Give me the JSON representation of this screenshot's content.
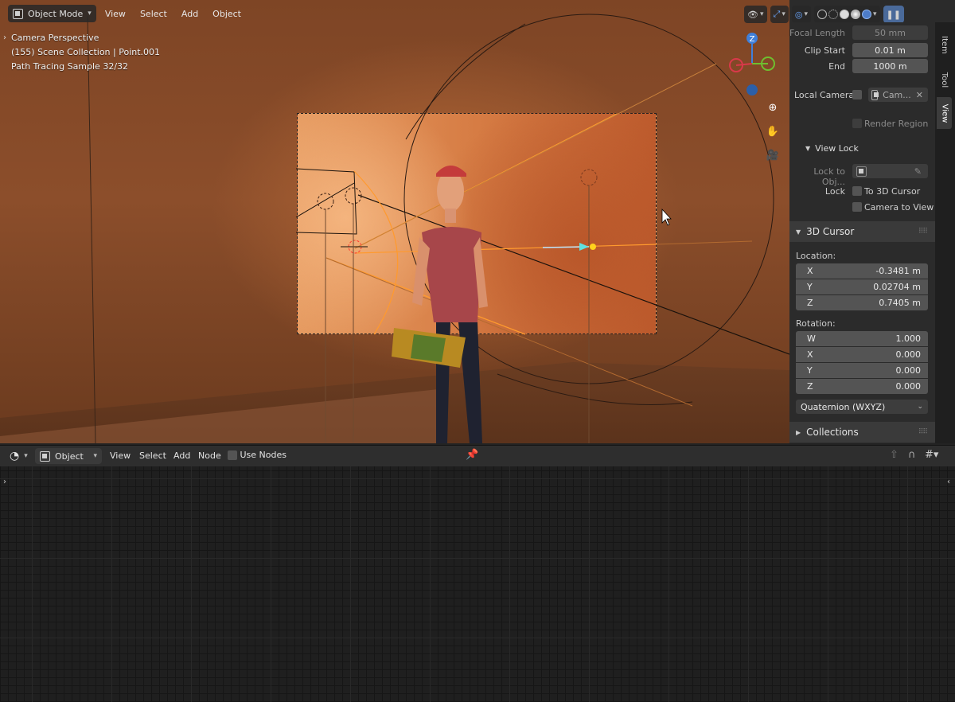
{
  "viewport": {
    "mode": "Object Mode",
    "menus": [
      "View",
      "Select",
      "Add",
      "Object"
    ],
    "overlay": {
      "line1": "Camera Perspective",
      "line2": "(155) Scene Collection | Point.001",
      "line3": "Path Tracing Sample 32/32"
    },
    "gizmo": {
      "z": "Z"
    },
    "icons": [
      "visibility-icon",
      "gizmo-icon",
      "overlay-icon",
      "xray-icon",
      "wireframe-shading-icon",
      "solid-shading-icon",
      "material-shading-icon",
      "rendered-shading-icon",
      "zoom-icon",
      "pan-hand-icon",
      "camera-view-icon"
    ]
  },
  "npanel": {
    "focal_length_label": "Focal Length",
    "focal_length_value": "50 mm",
    "clip_start_label": "Clip Start",
    "clip_start_value": "0.01 m",
    "end_label": "End",
    "end_value": "1000 m",
    "local_camera_label": "Local Camera",
    "local_camera_value": "Cam...",
    "render_region_label": "Render Region",
    "view_lock_title": "View Lock",
    "lock_to_obj_label": "Lock to Obj...",
    "lock_label": "Lock",
    "to_3d_cursor_label": "To 3D Cursor",
    "camera_to_view_label": "Camera to View",
    "cursor_title": "3D Cursor",
    "location_label": "Location:",
    "location": [
      {
        "axis": "X",
        "value": "-0.3481 m"
      },
      {
        "axis": "Y",
        "value": "0.02704 m"
      },
      {
        "axis": "Z",
        "value": "0.7405 m"
      }
    ],
    "rotation_label": "Rotation:",
    "rotation": [
      {
        "axis": "W",
        "value": "1.000"
      },
      {
        "axis": "X",
        "value": "0.000"
      },
      {
        "axis": "Y",
        "value": "0.000"
      },
      {
        "axis": "Z",
        "value": "0.000"
      }
    ],
    "rotation_mode": "Quaternion (WXYZ)",
    "collections_title": "Collections"
  },
  "tabs": [
    "Item",
    "Tool",
    "View"
  ],
  "node_editor": {
    "type_select": "Object",
    "menus": [
      "View",
      "Select",
      "Add",
      "Node"
    ],
    "use_nodes_label": "Use Nodes"
  }
}
